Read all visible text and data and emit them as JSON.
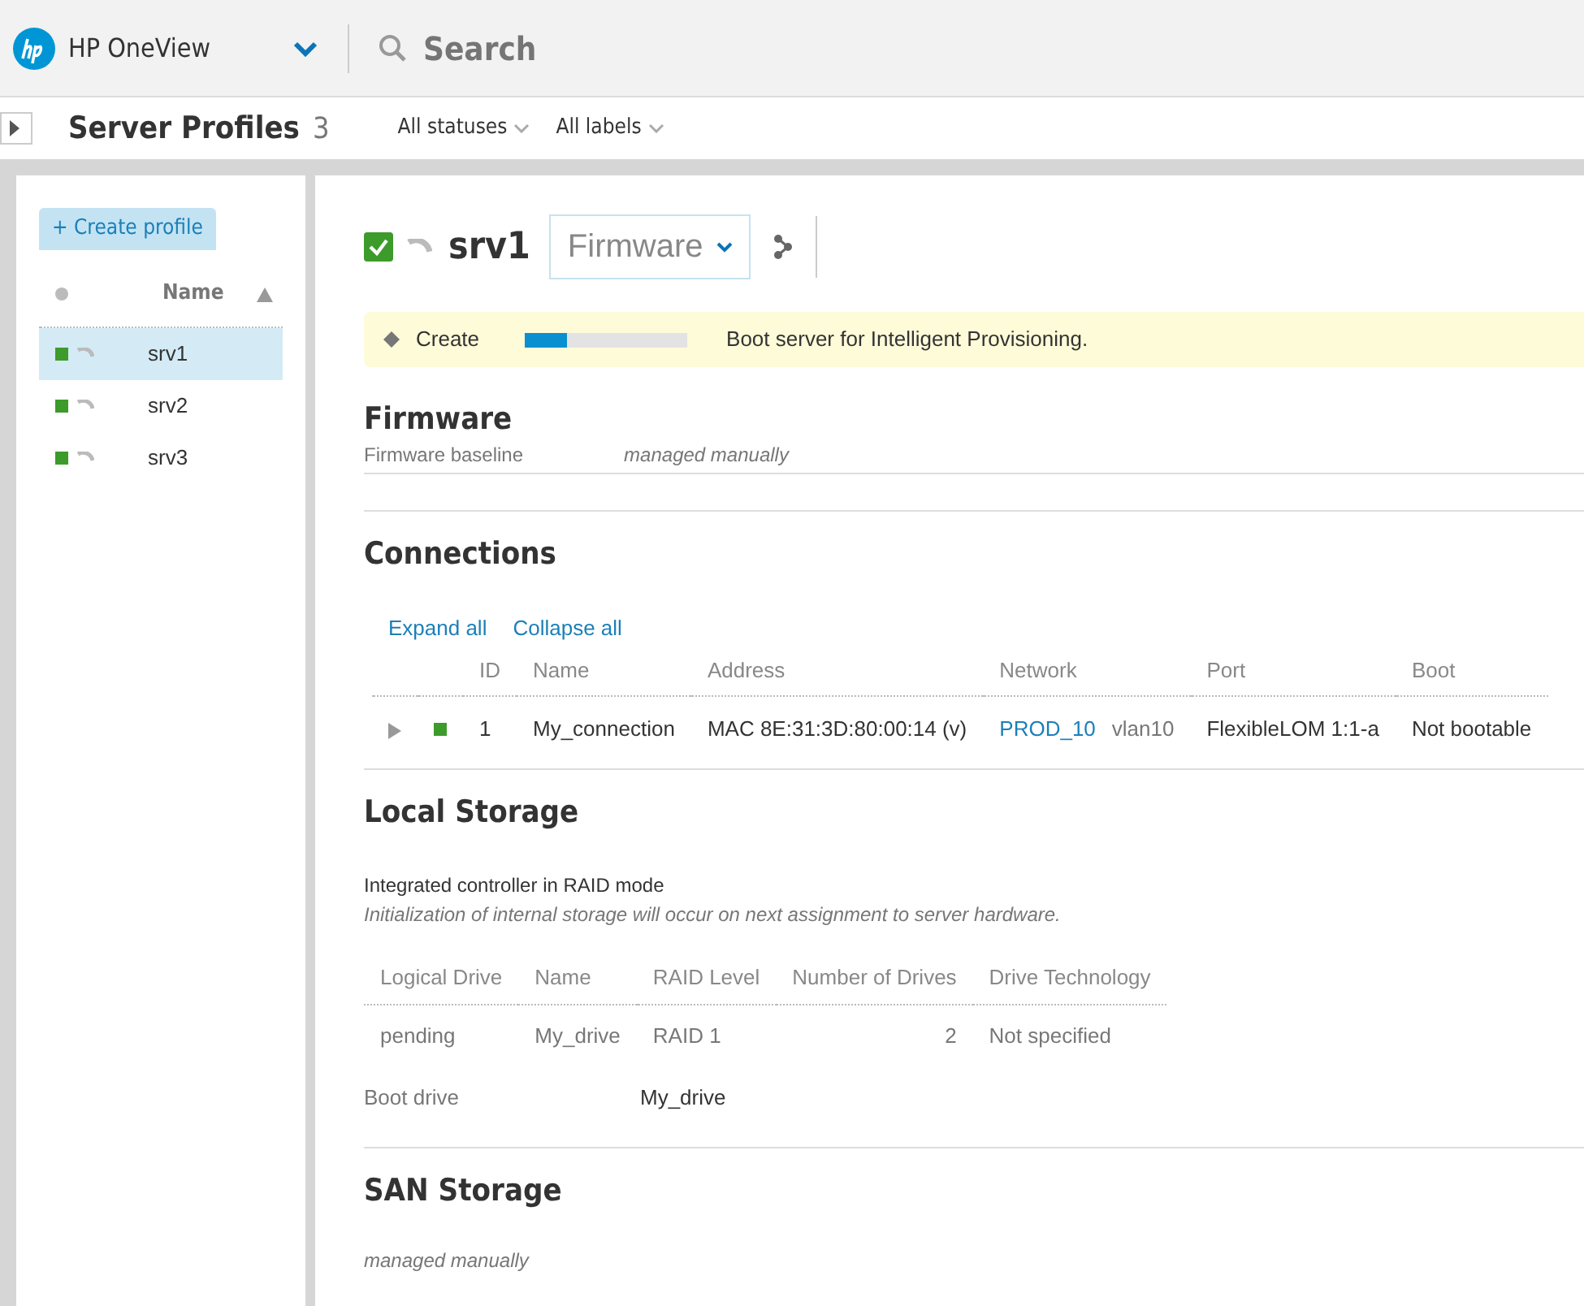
{
  "app": {
    "title": "HP OneView",
    "search_placeholder": "Search"
  },
  "page": {
    "title": "Server Profiles",
    "count": "3",
    "filters": [
      "All statuses",
      "All labels"
    ]
  },
  "sidebar": {
    "create_button": "+ Create profile",
    "column": "Name",
    "items": [
      {
        "name": "srv1",
        "selected": true,
        "color": "#3c9b2a"
      },
      {
        "name": "srv2",
        "selected": false,
        "color": "#3c9b2a"
      },
      {
        "name": "srv3",
        "selected": false,
        "color": "#3c9b2a"
      }
    ]
  },
  "detail": {
    "title": "srv1",
    "checked": true,
    "view_select": "Firmware",
    "task": {
      "name": "Create",
      "level": 0.26,
      "message": "Boot server for Intelligent Provisioning."
    },
    "firmware": {
      "heading": "Firmware",
      "label": "Firmware baseline",
      "value": "managed manually"
    },
    "connections": {
      "heading": "Connections",
      "links": [
        "Expand all",
        "Collapse all"
      ],
      "columns": [
        "ID",
        "Name",
        "Address",
        "Network",
        "Port",
        "Boot"
      ],
      "rows": [
        {
          "expanded": false,
          "color": "#3c9b2a",
          "id": "1",
          "name": "My_connection",
          "address": "MAC 8E:31:3D:80:00:14 (v)",
          "network": "PROD_10",
          "vlan": "vlan10",
          "port": "FlexibleLOM 1:1-a",
          "boot": "Not bootable"
        }
      ]
    },
    "local_storage": {
      "heading": "Local Storage",
      "controller": "Integrated controller in RAID mode",
      "note": "Initialization of internal storage will occur on next assignment to server hardware.",
      "columns": [
        "Logical Drive",
        "Name",
        "RAID Level",
        "Number of Drives",
        "Drive Technology"
      ],
      "rows": [
        [
          "pending",
          "My_drive",
          "RAID 1",
          "2",
          "Not specified"
        ]
      ],
      "boot_label": "Boot drive",
      "boot_value": "My_drive"
    },
    "san_storage": {
      "heading": "SAN Storage",
      "value": "managed manually"
    }
  }
}
